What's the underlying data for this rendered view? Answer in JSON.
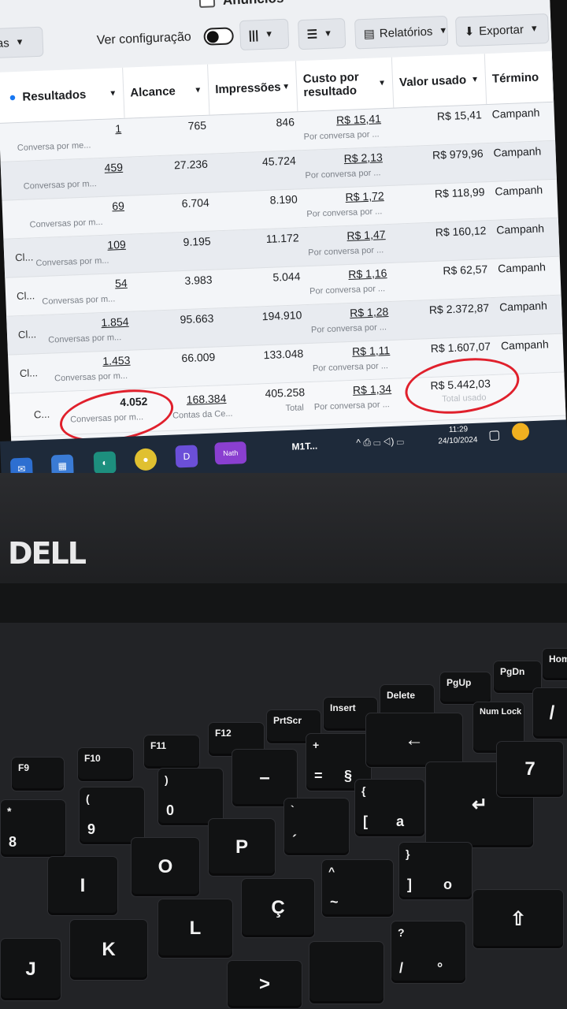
{
  "toolbar": {
    "ads_tab": "Anúncios",
    "dropdown_left": "as",
    "view_settings": "Ver configuração",
    "reports": "Relatórios",
    "export": "Exportar"
  },
  "columns": [
    "Resultados",
    "Alcance",
    "Impressões",
    "Custo por resultado",
    "Valor usado",
    "Término"
  ],
  "rows": [
    {
      "name": "",
      "results": "1",
      "results_sub": "Conversa por me...",
      "reach": "765",
      "impressions": "846",
      "cost": "R$ 15,41",
      "cost_sub": "Por conversa por ...",
      "spent": "R$ 15,41",
      "end": "Campanh"
    },
    {
      "name": "",
      "results": "459",
      "results_sub": "Conversas por m...",
      "reach": "27.236",
      "impressions": "45.724",
      "cost": "R$ 2,13",
      "cost_sub": "Por conversa por ...",
      "spent": "R$ 979,96",
      "end": "Campanh"
    },
    {
      "name": "",
      "results": "69",
      "results_sub": "Conversas por m...",
      "reach": "6.704",
      "impressions": "8.190",
      "cost": "R$ 1,72",
      "cost_sub": "Por conversa por ...",
      "spent": "R$ 118,99",
      "end": "Campanh"
    },
    {
      "name": "Cl...",
      "results": "109",
      "results_sub": "Conversas por m...",
      "reach": "9.195",
      "impressions": "11.172",
      "cost": "R$ 1,47",
      "cost_sub": "Por conversa por ...",
      "spent": "R$ 160,12",
      "end": "Campanh"
    },
    {
      "name": "Cl...",
      "results": "54",
      "results_sub": "Conversas por m...",
      "reach": "3.983",
      "impressions": "5.044",
      "cost": "R$ 1,16",
      "cost_sub": "Por conversa por ...",
      "spent": "R$ 62,57",
      "end": "Campanh"
    },
    {
      "name": "Cl...",
      "results": "1.854",
      "results_sub": "Conversas por m...",
      "reach": "95.663",
      "impressions": "194.910",
      "cost": "R$ 1,28",
      "cost_sub": "Por conversa por ...",
      "spent": "R$ 2.372,87",
      "end": "Campanh"
    },
    {
      "name": "Cl...",
      "results": "1.453",
      "results_sub": "Conversas por m...",
      "reach": "66.009",
      "impressions": "133.048",
      "cost": "R$ 1,11",
      "cost_sub": "Por conversa por ...",
      "spent": "R$ 1.607,07",
      "end": "Campanh"
    }
  ],
  "total": {
    "name": "C...",
    "results": "4.052",
    "results_sub": "Conversas por m...",
    "reach": "168.384",
    "reach_sub": "Contas da Ce...",
    "impressions": "405.258",
    "impressions_sub": "Total",
    "cost": "R$ 1,34",
    "cost_sub": "Por conversa por ...",
    "spent": "R$ 5.442,03",
    "spent_sub": "Total usado"
  },
  "taskbar": {
    "app": "M1T...",
    "user_tile": "Nath",
    "time": "11:29",
    "date": "24/10/2024"
  },
  "laptop": {
    "brand": "DELL"
  },
  "keys": {
    "f9": "F9",
    "f10": "F10",
    "f11": "F11",
    "f12": "F12",
    "prtscr": "PrtScr",
    "insert": "Insert",
    "delete": "Delete",
    "pgup": "PgUp",
    "pgdn": "PgDn",
    "home": "Hom",
    "numlock": "Num Lock",
    "asterisk": "*",
    "eight": "8",
    "paren_open": "(",
    "nine": "9",
    "paren_close": ")",
    "zero": "0",
    "minus": "–",
    "plus": "+",
    "equals": "=",
    "section": "§",
    "brace_open": "{",
    "bracket_open": "[",
    "ordinal_a": "a",
    "brace_close": "}",
    "bracket_close": "]",
    "ordinal_o": "o",
    "backtick": "`",
    "acute": "´",
    "caret": "^",
    "tilde": "~",
    "question": "?",
    "slash": "/",
    "degree": "°",
    "seven": "7",
    "letter_i": "I",
    "letter_o": "O",
    "letter_p": "P",
    "letter_k": "K",
    "letter_l": "L",
    "letter_c_cedilla": "Ç",
    "letter_j": "J"
  }
}
